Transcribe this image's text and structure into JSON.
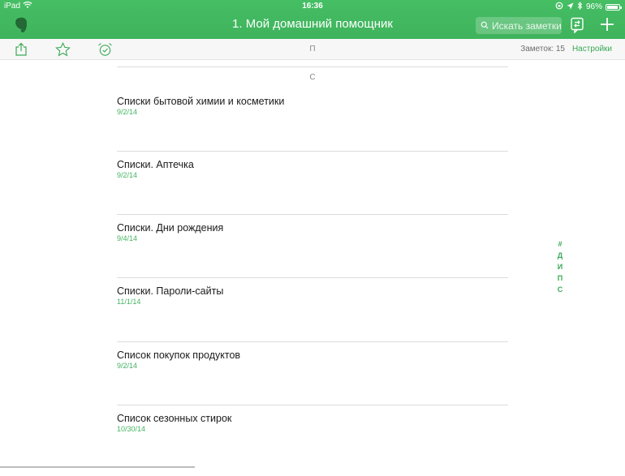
{
  "status_bar": {
    "carrier": "iPad",
    "time": "16:36",
    "battery": "96%",
    "battery_level": 0.96
  },
  "nav": {
    "title": "1. Мой домашний помощник",
    "search_placeholder": "Искать заметки",
    "icons": [
      "evernote-logo-icon",
      "search-icon",
      "sync-icon",
      "plus-icon"
    ]
  },
  "toolbar": {
    "icons": [
      "share-icon",
      "star-icon",
      "alarm-icon"
    ],
    "section_label": "П",
    "note_count": "Заметок: 15",
    "settings_label": "Настройки"
  },
  "list": {
    "section_label": "С",
    "notes": [
      {
        "title": "Списки бытовой химии и косметики",
        "date": "9/2/14"
      },
      {
        "title": "Списки. Аптечка",
        "date": "9/2/14"
      },
      {
        "title": "Списки. Дни рождения",
        "date": "9/4/14"
      },
      {
        "title": "Списки. Пароли-сайты",
        "date": "11/1/14"
      },
      {
        "title": "Список покупок продуктов",
        "date": "9/2/14"
      },
      {
        "title": "Список сезонных стирок",
        "date": "10/30/14"
      }
    ]
  },
  "index": [
    "#",
    "Д",
    "И",
    "П",
    "С"
  ],
  "colors": {
    "accent": "#3fb35c",
    "date_green": "#45b463",
    "separator": "#dcdcdc"
  }
}
